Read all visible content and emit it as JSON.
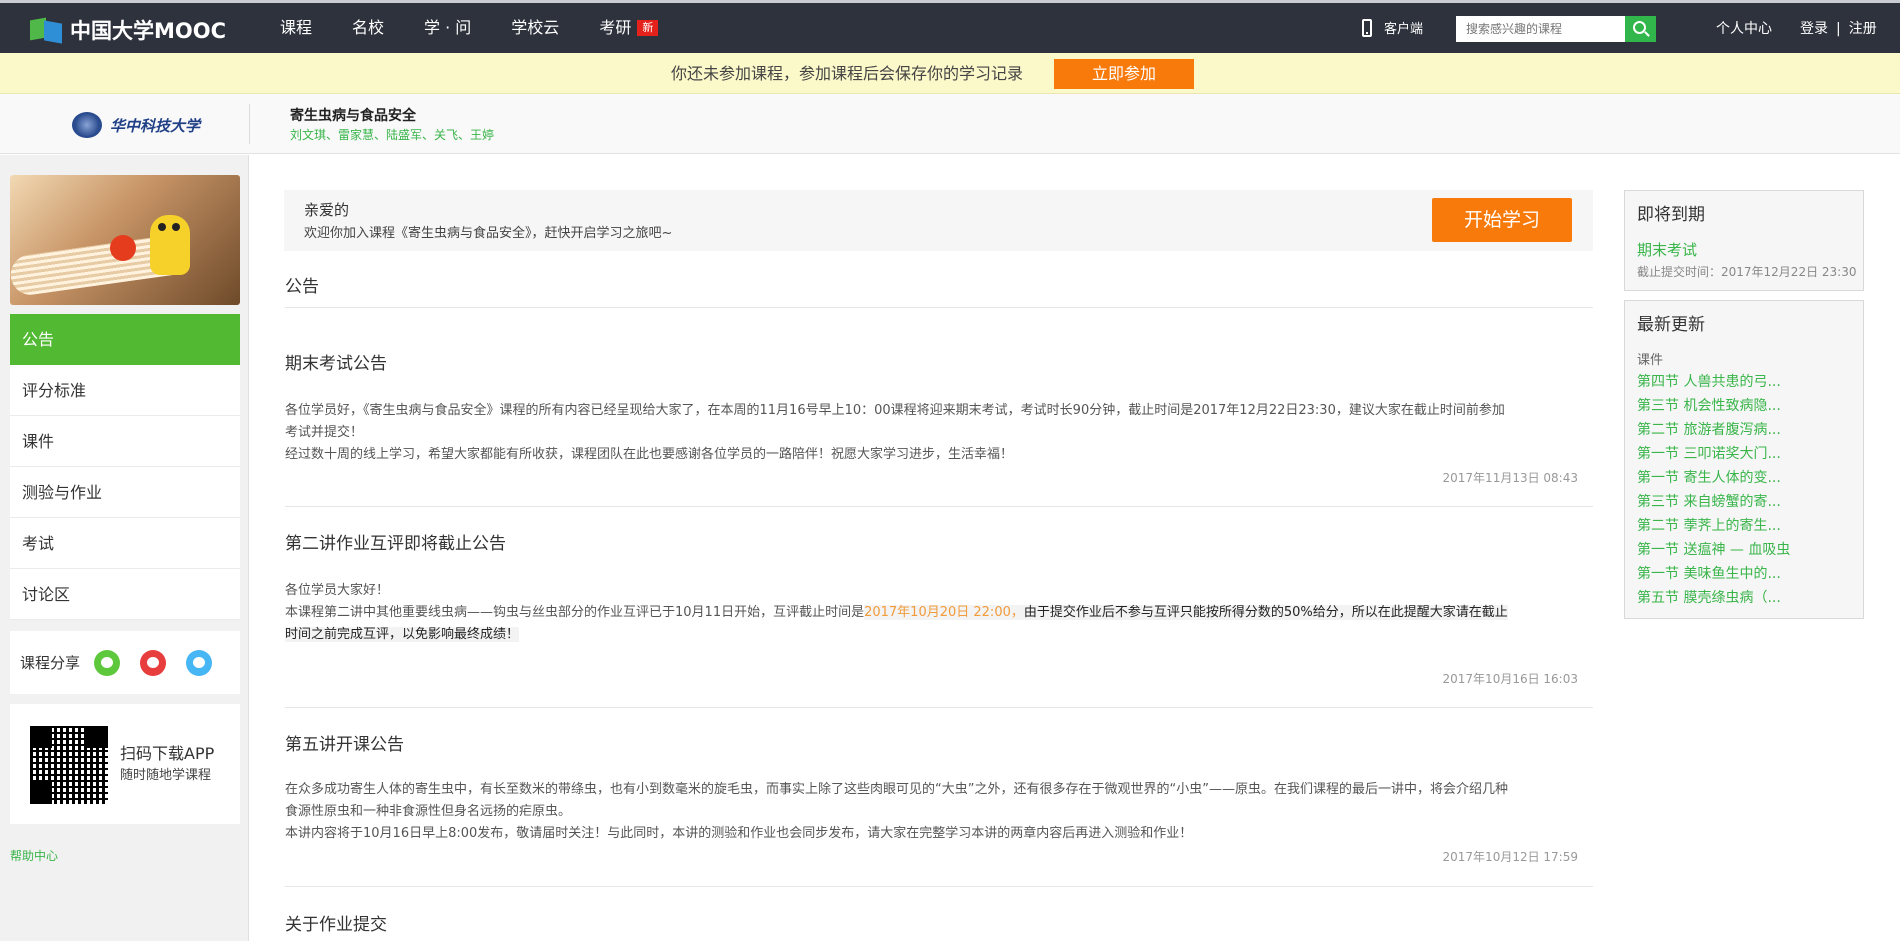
{
  "header": {
    "logo_text": "中国大学MOOC",
    "nav": [
      {
        "label": "课程"
      },
      {
        "label": "名校"
      },
      {
        "label": "学 · 问"
      },
      {
        "label": "学校云"
      },
      {
        "label": "考研",
        "badge": "新"
      }
    ],
    "client_label": "客户端",
    "search_placeholder": "搜索感兴趣的课程",
    "personal_center": "个人中心",
    "login": "登录",
    "separator": "|",
    "register": "注册"
  },
  "join_bar": {
    "text": "你还未参加课程，参加课程后会保存你的学习记录",
    "button": "立即参加"
  },
  "course": {
    "university": "华中科技大学",
    "title": "寄生虫病与食品安全",
    "teachers": "刘文琪、雷家慧、陆盛军、关飞、王婷"
  },
  "sidebar": {
    "menu": [
      {
        "label": "公告",
        "active": true
      },
      {
        "label": "评分标准"
      },
      {
        "label": "课件"
      },
      {
        "label": "测验与作业"
      },
      {
        "label": "考试"
      },
      {
        "label": "讨论区"
      }
    ],
    "share_label": "课程分享",
    "app_title": "扫码下载APP",
    "app_sub": "随时随地学课程",
    "help": "帮助中心"
  },
  "welcome": {
    "title": "亲爱的",
    "text": "欢迎你加入课程《寄生虫病与食品安全》，赶快开启学习之旅吧~",
    "start_button": "开始学习"
  },
  "announcements": {
    "section_title": "公告",
    "items": [
      {
        "title": "期末考试公告",
        "line1": "各位学员好，《寄生虫病与食品安全》课程的所有内容已经呈现给大家了，在本周的11月16号早上10：00课程将迎来期末考试，考试时长90分钟，截止时间是2017年12月22日23:30，建议大家在截止时间前参加",
        "line2": "考试并提交！",
        "line3": "经过数十周的线上学习，希望大家都能有所收获，课程团队在此也要感谢各位学员的一路陪伴！祝愿大家学习进步，生活幸福！",
        "time": "2017年11月13日 08:43"
      },
      {
        "title": "第二讲作业互评即将截止公告",
        "line1": "各位学员大家好！",
        "line2a": "本课程第二讲中其他重要线虫病——钩虫与丝虫部分的作业互评已于10月11日开始，互评截止时间是",
        "line2_date": "2017年10月20日 22:00，",
        "line2b": "由于提交作业后不参与互评只能按所得分数的50%给分，所以在此提醒大家请在截止",
        "line3": "时间之前完成互评，以免影响最终成绩！",
        "time": "2017年10月16日 16:03"
      },
      {
        "title": "第五讲开课公告",
        "line1": "在众多成功寄生人体的寄生虫中，有长至数米的带绦虫，也有小到数毫米的旋毛虫，而事实上除了这些肉眼可见的“大虫”之外，还有很多存在于微观世界的“小虫”——原虫。在我们课程的最后一讲中，将会介绍几种",
        "line2": "食源性原虫和一种非食源性但身名远扬的疟原虫。",
        "line3": "本讲内容将于10月16日早上8:00发布，敬请届时关注！与此同时，本讲的测验和作业也会同步发布，请大家在完整学习本讲的两章内容后再进入测验和作业！",
        "time": "2017年10月12日 17:59"
      },
      {
        "title": "关于作业提交"
      }
    ]
  },
  "due_panel": {
    "title": "即将到期",
    "item": "期末考试",
    "deadline": "截止提交时间：2017年12月22日 23:30"
  },
  "updates_panel": {
    "title": "最新更新",
    "category": "课件",
    "items": [
      "第四节 人兽共患的弓...",
      "第三节 机会性致病隐...",
      "第二节 旅游者腹泻病...",
      "第一节 三叩诺奖大门...",
      "第一节 寄生人体的变...",
      "第三节 来自螃蟹的寄...",
      "第二节 荸荠上的寄生...",
      "第一节 送瘟神 — 血吸虫",
      "第一节 美味鱼生中的...",
      "第五节 膜壳绦虫病（..."
    ]
  }
}
